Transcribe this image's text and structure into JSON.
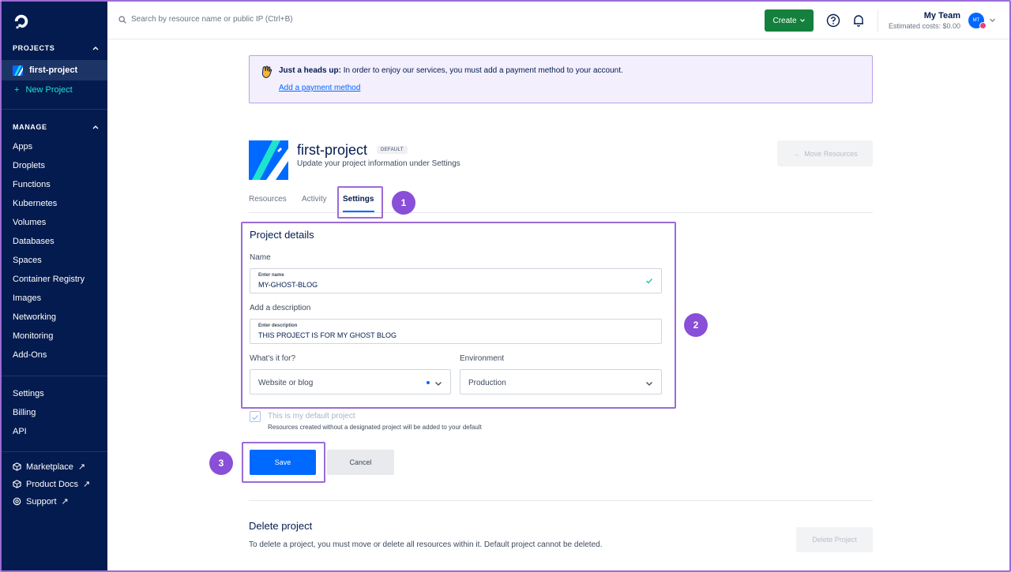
{
  "sidebar": {
    "projects_heading": "PROJECTS",
    "current_project": "first-project",
    "new_project": "New Project",
    "manage_heading": "MANAGE",
    "manage_items": [
      "Apps",
      "Droplets",
      "Functions",
      "Kubernetes",
      "Volumes",
      "Databases",
      "Spaces",
      "Container Registry",
      "Images",
      "Networking",
      "Monitoring",
      "Add-Ons"
    ],
    "account_items": [
      "Settings",
      "Billing",
      "API"
    ],
    "external_items": [
      "Marketplace",
      "Product Docs",
      "Support"
    ]
  },
  "topbar": {
    "search_placeholder": "Search by resource name or public IP (Ctrl+B)",
    "create_label": "Create",
    "team_name": "My Team",
    "estimated_costs": "Estimated costs: $0.00",
    "avatar_initials": "MT"
  },
  "banner": {
    "heading": "Just a heads up:",
    "message": "In order to enjoy our services, you must add a payment method to your account.",
    "link": "Add a payment method"
  },
  "project": {
    "title": "first-project",
    "badge": "DEFAULT",
    "subtitle": "Update your project information under Settings",
    "move_resources": "Move Resources"
  },
  "tabs": [
    "Resources",
    "Activity",
    "Settings"
  ],
  "steps": [
    "1",
    "2",
    "3"
  ],
  "details": {
    "title": "Project details",
    "name_label": "Name",
    "name_placeholder": "Enter name",
    "name_value": "MY-GHOST-BLOG",
    "desc_label": "Add a description",
    "desc_placeholder": "Enter description",
    "desc_value": "THIS PROJECT IS FOR MY GHOST BLOG",
    "purpose_label": "What's it for?",
    "purpose_value": "Website or blog",
    "env_label": "Environment",
    "env_value": "Production"
  },
  "default_checkbox": {
    "label": "This is my default project",
    "sub": "Resources created without a designated project will be added to your default"
  },
  "actions": {
    "save": "Save",
    "cancel": "Cancel"
  },
  "delete": {
    "title": "Delete project",
    "text": "To delete a project, you must move or delete all resources within it. Default project cannot be deleted.",
    "button": "Delete Project"
  },
  "colors": {
    "brand": "#0069ff",
    "sidebar": "#031b4e",
    "highlight": "#9b6bd6",
    "create": "#15803d"
  }
}
